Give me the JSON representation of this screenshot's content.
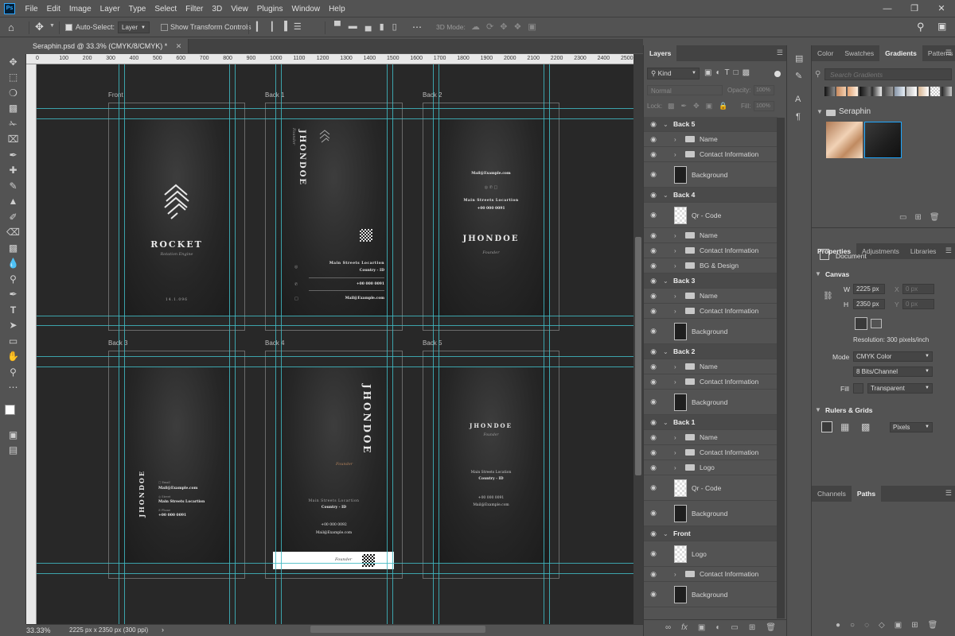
{
  "menubar": {
    "logo": "Ps",
    "items": [
      "File",
      "Edit",
      "Image",
      "Layer",
      "Type",
      "Select",
      "Filter",
      "3D",
      "View",
      "Plugins",
      "Window",
      "Help"
    ]
  },
  "options": {
    "auto_select_label": "Auto-Select:",
    "auto_select_value": "Layer",
    "show_transform_label": "Show Transform Controls",
    "mode_3d_label": "3D Mode:"
  },
  "document": {
    "tab_title": "Seraphin.psd @ 33.3% (CMYK/8/CMYK) *",
    "zoom": "33.33%",
    "size_info": "2225 px x 2350 px (300 ppi)"
  },
  "ruler_ticks": [
    "0",
    "100",
    "200",
    "300",
    "400",
    "500",
    "600",
    "700",
    "800",
    "900",
    "1000",
    "1100",
    "1200",
    "1300",
    "1400",
    "1500",
    "1600",
    "1700",
    "1800",
    "1900",
    "2000",
    "2100",
    "2200",
    "2300",
    "2400",
    "2500"
  ],
  "artboards": {
    "front": {
      "label": "Front",
      "logo_text": "ROCKET",
      "tagline": "Rotation Engine",
      "footer": "14.1.096"
    },
    "back1": {
      "label": "Back 1",
      "name": "JHONDOE",
      "role": "Founder",
      "address": "Main Streets Locartion",
      "country": "Country - ID",
      "phone": "+00 000 0091",
      "mail": "Mail@Example.com"
    },
    "back2": {
      "label": "Back 2",
      "mail": "Mail@Example.com",
      "address": "Main Streets Locartion",
      "phone": "+00 000 0091",
      "name": "JHONDOE",
      "role": "Founder"
    },
    "back3": {
      "label": "Back 3",
      "name": "JHONDOE",
      "email_label": "Email",
      "mail": "Mail@Example.com",
      "street_label": "Street",
      "address": "Main Streets Locartion",
      "phone_label": "Phone",
      "phone": "+00 000 0091"
    },
    "back4": {
      "label": "Back 4",
      "name": "JHONDOE",
      "role": "Founder",
      "address": "Main Streets Locartion",
      "country": "Country - ID",
      "phone": "+00 000 0092",
      "mail": "Mail@Example.com",
      "strip_role": "Founder"
    },
    "back5": {
      "label": "Back 5",
      "name": "JHONDOE",
      "role": "Founder",
      "address": "Main Streets Location",
      "country": "Country - ID",
      "phone": "+00 000 0091",
      "mail": "Mail@Example.com"
    }
  },
  "layers_panel": {
    "tab": "Layers",
    "filter_kind": "Kind",
    "blend_mode": "Normal",
    "opacity_label": "Opacity:",
    "opacity_value": "100%",
    "lock_label": "Lock:",
    "fill_label": "Fill:",
    "fill_value": "100%",
    "rows": [
      {
        "type": "group",
        "name": "Back 5"
      },
      {
        "type": "folder",
        "name": "Name"
      },
      {
        "type": "folder",
        "name": "Contact Information"
      },
      {
        "type": "image",
        "name": "Background"
      },
      {
        "type": "group",
        "name": "Back 4"
      },
      {
        "type": "smart",
        "name": "Qr - Code"
      },
      {
        "type": "folder",
        "name": "Name"
      },
      {
        "type": "folder",
        "name": "Contact Information"
      },
      {
        "type": "folder",
        "name": "BG & Design"
      },
      {
        "type": "group",
        "name": "Back 3"
      },
      {
        "type": "folder",
        "name": "Name"
      },
      {
        "type": "folder",
        "name": "Contact Information"
      },
      {
        "type": "image",
        "name": "Background"
      },
      {
        "type": "group",
        "name": "Back 2"
      },
      {
        "type": "folder",
        "name": "Name"
      },
      {
        "type": "folder",
        "name": "Contact Information"
      },
      {
        "type": "image",
        "name": "Background"
      },
      {
        "type": "group",
        "name": "Back 1"
      },
      {
        "type": "folder",
        "name": "Name"
      },
      {
        "type": "folder",
        "name": "Contact Information"
      },
      {
        "type": "folder",
        "name": "Logo"
      },
      {
        "type": "smart",
        "name": "Qr - Code"
      },
      {
        "type": "image",
        "name": "Background"
      },
      {
        "type": "group",
        "name": "Front"
      },
      {
        "type": "smart",
        "name": "Logo"
      },
      {
        "type": "folder",
        "name": "Contact Information"
      },
      {
        "type": "image",
        "name": "Background"
      }
    ]
  },
  "gradients_panel": {
    "tabs": [
      "Color",
      "Swatches",
      "Gradients",
      "Patterns"
    ],
    "active_tab": "Gradients",
    "search_placeholder": "Search Gradients",
    "folder_name": "Seraphin"
  },
  "properties_panel": {
    "tabs": [
      "Properties",
      "Adjustments",
      "Libraries"
    ],
    "active_tab": "Properties",
    "document_label": "Document",
    "canvas_heading": "Canvas",
    "w_label": "W",
    "w_value": "2225 px",
    "h_label": "H",
    "h_value": "2350 px",
    "x_label": "X",
    "x_placeholder": "0 px",
    "y_label": "Y",
    "y_placeholder": "0 px",
    "resolution": "Resolution: 300 pixels/inch",
    "mode_label": "Mode",
    "mode_value": "CMYK Color",
    "bits_value": "8 Bits/Channel",
    "fill_label": "Fill",
    "fill_value": "Transparent",
    "rulers_heading": "Rulers & Grids",
    "units_value": "Pixels"
  },
  "channels_panel": {
    "tabs": [
      "Channels",
      "Paths"
    ],
    "active_tab": "Paths"
  }
}
